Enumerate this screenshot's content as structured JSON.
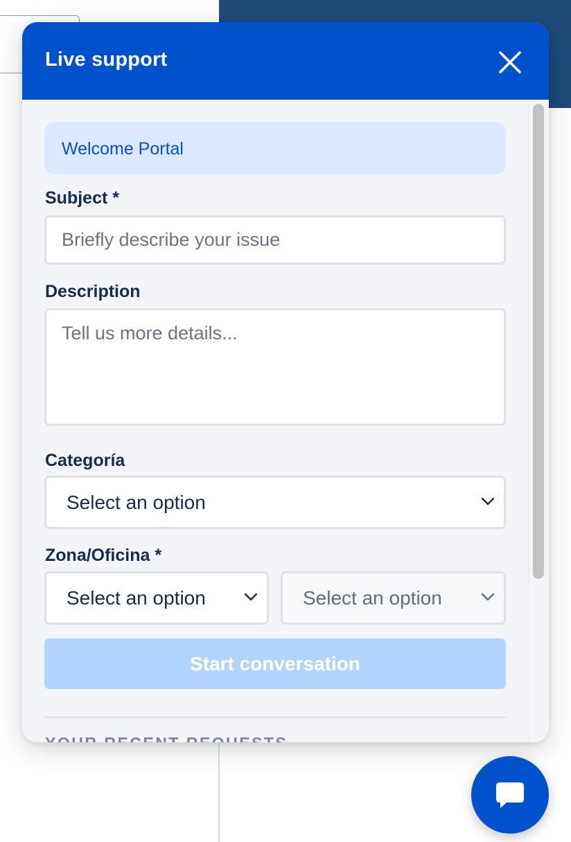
{
  "widget": {
    "title": "Live support",
    "banner_text": "Welcome Portal",
    "subject": {
      "label": "Subject *",
      "placeholder": "Briefly describe your issue",
      "value": ""
    },
    "description": {
      "label": "Description",
      "placeholder": "Tell us more details...",
      "value": ""
    },
    "categoria": {
      "label": "Categoría",
      "selected": "Select an option"
    },
    "zona": {
      "label": "Zona/Oficina *",
      "primary_selected": "Select an option",
      "secondary_selected": "Select an option"
    },
    "start_button_label": "Start conversation",
    "recent_heading": "YOUR RECENT REQUESTS"
  },
  "icons": {
    "close": "close-icon",
    "chevron": "chevron-down-icon",
    "chat": "chat-bubble-icon"
  },
  "colors": {
    "brand": "#0052cc",
    "banner_bg": "#dce9fd",
    "button_disabled": "#b3d4ff",
    "label": "#172b4d"
  }
}
